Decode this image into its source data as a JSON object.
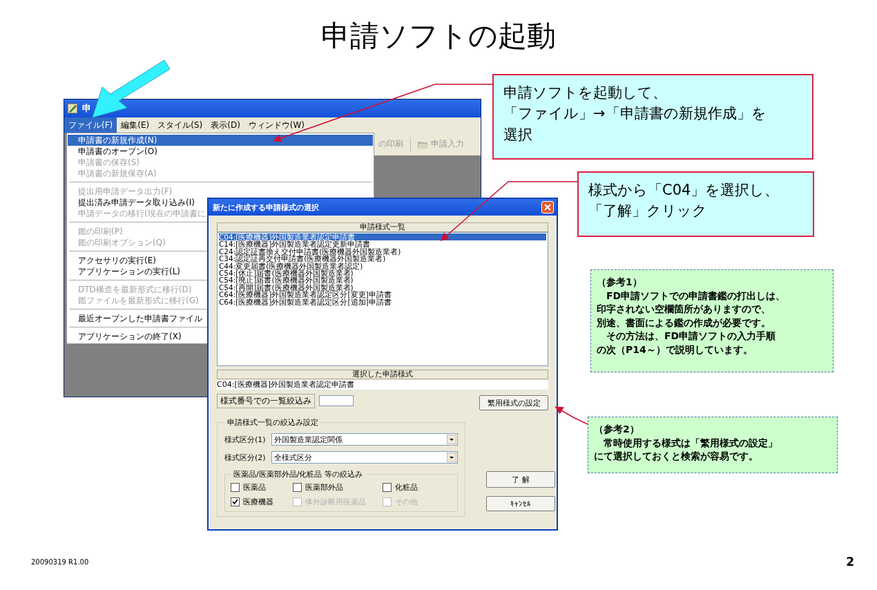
{
  "title": "申請ソフトの起動",
  "app_window": {
    "title": "申",
    "menu_bar": [
      {
        "label": "ファイル(F)",
        "selected": true
      },
      {
        "label": "編集(E)",
        "selected": false
      },
      {
        "label": "スタイル(S)",
        "selected": false
      },
      {
        "label": "表示(D)",
        "selected": false
      },
      {
        "label": "ウィンドウ(W)",
        "selected": false
      }
    ],
    "file_menu": [
      {
        "kind": "item",
        "label": "申請書の新規作成(N)",
        "selected": true,
        "disabled": false
      },
      {
        "kind": "item",
        "label": "申請書のオープン(O)",
        "selected": false,
        "disabled": false
      },
      {
        "kind": "item",
        "label": "申請書の保存(S)",
        "selected": false,
        "disabled": true
      },
      {
        "kind": "item",
        "label": "申請書の新規保存(A)",
        "selected": false,
        "disabled": true
      },
      {
        "kind": "separator"
      },
      {
        "kind": "item",
        "label": "提出用申請データ出力(F)",
        "selected": false,
        "disabled": true
      },
      {
        "kind": "item",
        "label": "提出済み申請データ取り込み(I)",
        "selected": false,
        "disabled": false
      },
      {
        "kind": "item",
        "label": "申請データの移行(現在の申請書に",
        "selected": false,
        "disabled": true
      },
      {
        "kind": "separator"
      },
      {
        "kind": "item",
        "label": "鑑の印刷(P)",
        "selected": false,
        "disabled": true
      },
      {
        "kind": "item",
        "label": "鑑の印刷オプション(Q)",
        "selected": false,
        "disabled": true
      },
      {
        "kind": "separator"
      },
      {
        "kind": "item",
        "label": "アクセサリの実行(E)",
        "selected": false,
        "disabled": false
      },
      {
        "kind": "item",
        "label": "アプリケーションの実行(L)",
        "selected": false,
        "disabled": false
      },
      {
        "kind": "separator"
      },
      {
        "kind": "item",
        "label": "DTD構造を最新形式に移行(D)",
        "selected": false,
        "disabled": true
      },
      {
        "kind": "item",
        "label": "鑑ファイルを最新形式に移行(G)",
        "selected": false,
        "disabled": true
      },
      {
        "kind": "separator"
      },
      {
        "kind": "item",
        "label": "最近オープンした申請書ファイル",
        "selected": false,
        "disabled": false
      },
      {
        "kind": "separator"
      },
      {
        "kind": "item",
        "label": "アプリケーションの終了(X)",
        "selected": false,
        "disabled": false
      }
    ],
    "toolbar": [
      {
        "label": "の印刷"
      },
      {
        "label": "申請入力"
      }
    ]
  },
  "dialog": {
    "title": "新たに作成する申請様式の選択",
    "list_heading": "申請様式一覧",
    "forms": [
      {
        "label": "C04:[医療機器]外国製造業者認定申請書",
        "selected": true
      },
      {
        "label": "C14:[医療機器]外国製造業者認定更新申請書",
        "selected": false
      },
      {
        "label": "C24:認定証書換え交付申請書(医療機器外国製造業者)",
        "selected": false
      },
      {
        "label": "C34:認定証再交付申請書(医療機器外国製造業者)",
        "selected": false
      },
      {
        "label": "C44:変更届書(医療機器外国製造業者認定)",
        "selected": false
      },
      {
        "label": "C54:[休止]届書(医療機器外国製造業者)",
        "selected": false
      },
      {
        "label": "C54:[廃止]届書(医療機器外国製造業者)",
        "selected": false
      },
      {
        "label": "C54:[再開]届書(医療機器外国製造業者)",
        "selected": false
      },
      {
        "label": "C64:[医療機器]外国製造業者認定区分[変更]申請書",
        "selected": false
      },
      {
        "label": "C64:[医療機器]外国製造業者認定区分[追加]申請書",
        "selected": false
      }
    ],
    "selected_heading": "選択した申請様式",
    "selected_value": "C04:[医療機器]外国製造業者認定申請書",
    "number_filter_label": "様式番号での一覧絞込み",
    "favorites_button": "繁用様式の設定",
    "filter_group": {
      "title": "申請様式一覧の絞込み設定",
      "dropdowns": [
        {
          "label": "様式区分(1)",
          "value": "外国製造業認定関係"
        },
        {
          "label": "様式区分(2)",
          "value": "全様式区分"
        }
      ],
      "category_group": {
        "title": "医薬品/医薬部外品/化粧品 等の絞込み",
        "checkboxes": [
          {
            "label": "医薬品",
            "checked": false,
            "disabled": false
          },
          {
            "label": "医薬部外品",
            "checked": false,
            "disabled": false
          },
          {
            "label": "化粧品",
            "checked": false,
            "disabled": false
          },
          {
            "label": "医療機器",
            "checked": true,
            "disabled": false
          },
          {
            "label": "体外診断用医薬品",
            "checked": false,
            "disabled": true
          },
          {
            "label": "その他",
            "checked": false,
            "disabled": true
          }
        ]
      }
    },
    "ok_button": "了 解",
    "cancel_button": "ｷｬﾝｾﾙ"
  },
  "callouts": [
    {
      "lines": [
        "申請ソフトを起動して、",
        "「ファイル」→「申請書の新規作成」を",
        "選択"
      ]
    },
    {
      "lines": [
        "様式から「C04」を選択し、",
        "「了解」クリック"
      ]
    }
  ],
  "notes": [
    {
      "heading": "（参考1）",
      "lines": [
        "　FD申請ソフトでの申請書鑑の打出しは、",
        "印字されない空欄箇所がありますので、",
        "別途、書面による鑑の作成が必要です。",
        "　その方法は、FD申請ソフトの入力手順",
        "の次（P14～）で説明しています。"
      ]
    },
    {
      "heading": "（参考2）",
      "lines": [
        "　常時使用する様式は「繁用様式の設定」",
        "にて選択しておくと検索が容易です。"
      ]
    }
  ],
  "footer": {
    "version": "20090319 R1.00",
    "page": "2"
  }
}
